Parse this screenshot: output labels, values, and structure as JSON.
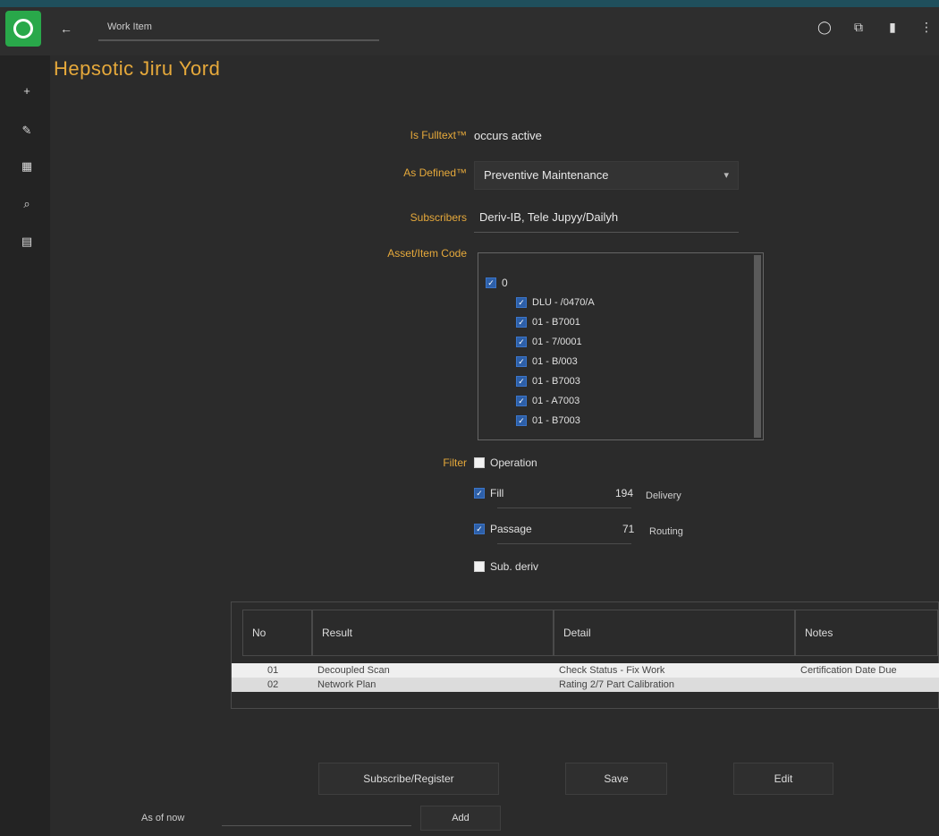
{
  "app": {
    "tab_title": "Work Item",
    "back_icon": "arrow-left-icon",
    "top_icons": [
      "circle-icon",
      "copy-icon",
      "bookmark-icon",
      "more-icon"
    ],
    "sidebar_icons": [
      "plus-icon",
      "pin-icon",
      "file-icon",
      "search-icon",
      "grid-icon"
    ]
  },
  "page": {
    "title": "Hepsotic Jiru Yord"
  },
  "form": {
    "field1_label": "Is Fulltext™",
    "field1_value": "occurs active",
    "field2_label": "As Defined™",
    "field2_value": "Preventive Maintenance",
    "field3_label": "Subscribers",
    "field3_value": "Deriv-IB, Tele Jupyy/Dailyh",
    "tree_label": "Asset/Item Code",
    "tree_root": "0",
    "tree_items": [
      "DLU - /0470/A",
      "01 - B7001",
      "01 - 7/0001",
      "01 - B/003",
      "01 - B7003",
      "01 - A7003",
      "01 - B7003"
    ]
  },
  "options": {
    "label": "Filter",
    "row1": "Operation",
    "row2": "Fill",
    "row2_value": "194",
    "row2_unit": "Delivery",
    "row3": "Passage",
    "row3_value": "71",
    "row3_unit": "Routing",
    "row4": "Sub. deriv"
  },
  "table": {
    "headers": [
      "No",
      "Result",
      "Detail",
      "Notes"
    ],
    "rows": [
      [
        "01",
        "Decoupled Scan",
        "Check Status - Fix Work",
        "Certification Date Due"
      ],
      [
        "02",
        "Network Plan",
        "Rating 2/7 Part Calibration",
        ""
      ]
    ]
  },
  "buttons": {
    "primary": "Subscribe/Register",
    "save": "Save",
    "edit": "Edit"
  },
  "footer": {
    "label": "As of now",
    "button": "Add"
  }
}
